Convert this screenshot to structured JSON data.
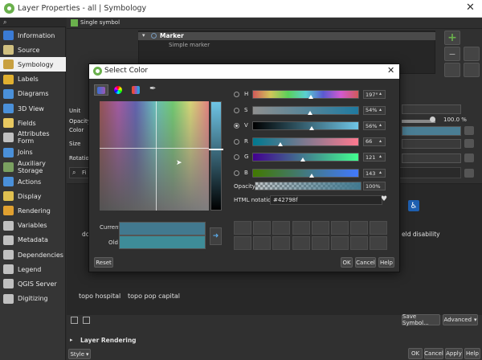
{
  "window": {
    "title": "Layer Properties - all | Symbology",
    "close_glyph": "✕"
  },
  "sidebar": {
    "items": [
      {
        "label": "Information",
        "icon": "info-icon",
        "color": "#3a7bd5"
      },
      {
        "label": "Source",
        "icon": "source-icon",
        "color": "#d0c080"
      },
      {
        "label": "Symbology",
        "icon": "symbology-icon",
        "color": "#c8a040"
      },
      {
        "label": "Labels",
        "icon": "labels-icon",
        "color": "#e0b030"
      },
      {
        "label": "Diagrams",
        "icon": "diagrams-icon",
        "color": "#4a90d9"
      },
      {
        "label": "3D View",
        "icon": "3d-view-icon",
        "color": "#4a90d9"
      },
      {
        "label": "Fields",
        "icon": "fields-icon",
        "color": "#e8c860"
      },
      {
        "label": "Attributes Form",
        "icon": "attributes-form-icon",
        "color": "#c0c0c0"
      },
      {
        "label": "Joins",
        "icon": "joins-icon",
        "color": "#4a90d9"
      },
      {
        "label": "Auxiliary Storage",
        "icon": "auxiliary-storage-icon",
        "color": "#7aa060"
      },
      {
        "label": "Actions",
        "icon": "actions-icon",
        "color": "#4a90d9"
      },
      {
        "label": "Display",
        "icon": "display-icon",
        "color": "#e0c050"
      },
      {
        "label": "Rendering",
        "icon": "rendering-icon",
        "color": "#e0a030"
      },
      {
        "label": "Variables",
        "icon": "variables-icon",
        "color": "#c0c0c0"
      },
      {
        "label": "Metadata",
        "icon": "metadata-icon",
        "color": "#c0c0c0"
      },
      {
        "label": "Dependencies",
        "icon": "dependencies-icon",
        "color": "#c0c0c0"
      },
      {
        "label": "Legend",
        "icon": "legend-icon",
        "color": "#c0c0c0"
      },
      {
        "label": "QGIS Server",
        "icon": "qgis-server-icon",
        "color": "#c0c0c0"
      },
      {
        "label": "Digitizing",
        "icon": "digitizing-icon",
        "color": "#c0c0c0"
      }
    ]
  },
  "main": {
    "renderer": "Single symbol",
    "tree": {
      "marker": "Marker",
      "sub": "Simple marker"
    },
    "props": {
      "unit": "Unit",
      "opacity": "Opacity",
      "color": "Color",
      "size": "Size",
      "rotation": "Rotation"
    },
    "opacity_value": "100.0 %",
    "filter_placeholder": "Fi",
    "behind_text_left": "do",
    "behind_text_right": "eld disability",
    "symbol_names": [
      "topo hospital",
      "topo pop capital"
    ],
    "save_symbol": "Save Symbol...",
    "advanced": "Advanced",
    "layer_rendering": "Layer Rendering",
    "style": "Style",
    "ok": "OK",
    "cancel": "Cancel",
    "apply": "Apply",
    "help": "Help"
  },
  "dialog": {
    "title": "Select Color",
    "channels": [
      {
        "key": "H",
        "value": "197°",
        "checked": false,
        "thumb": 0.55
      },
      {
        "key": "S",
        "value": "54%",
        "checked": false,
        "thumb": 0.54
      },
      {
        "key": "V",
        "value": "56%",
        "checked": true,
        "thumb": 0.56
      },
      {
        "key": "R",
        "value": "66",
        "checked": false,
        "thumb": 0.26
      },
      {
        "key": "G",
        "value": "121",
        "checked": false,
        "thumb": 0.47
      },
      {
        "key": "B",
        "value": "143",
        "checked": false,
        "thumb": 0.56
      }
    ],
    "opacity_label": "Opacity",
    "opacity_value": "100%",
    "html_label": "HTML notation",
    "html_value": "#42798f",
    "current_label": "Current",
    "old_label": "Old",
    "current_color": "#42798f",
    "old_color": "#3e8c98",
    "reset": "Reset",
    "ok": "OK",
    "cancel": "Cancel",
    "help": "Help"
  }
}
